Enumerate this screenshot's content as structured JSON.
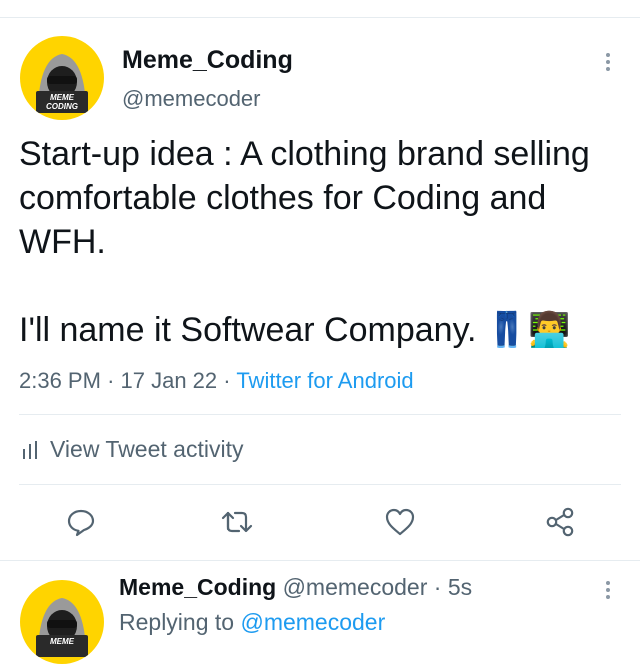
{
  "tweet": {
    "author_name": "Meme_Coding",
    "author_handle": "@memecoder",
    "avatar_text_line1": "MEME",
    "avatar_text_line2": "CODING",
    "text": "Start-up idea : A clothing brand selling comfortable clothes for Coding and WFH.\n\nI'll name it Softwear Company. 👖👨‍💻",
    "time": "2:36 PM",
    "date": "17 Jan 22",
    "separator": "·",
    "source": "Twitter for Android",
    "activity_label": "View Tweet activity"
  },
  "actions": [
    "reply-icon",
    "retweet-icon",
    "like-icon",
    "share-icon"
  ],
  "reply": {
    "author_name": "Meme_Coding",
    "author_handle": "@memecoder",
    "separator": "·",
    "time_ago": "5s",
    "replying_prefix": "Replying to",
    "replying_to": "@memecoder"
  },
  "colors": {
    "link": "#1d9bf0",
    "muted": "#536471",
    "avatar_bg": "#ffd400"
  }
}
